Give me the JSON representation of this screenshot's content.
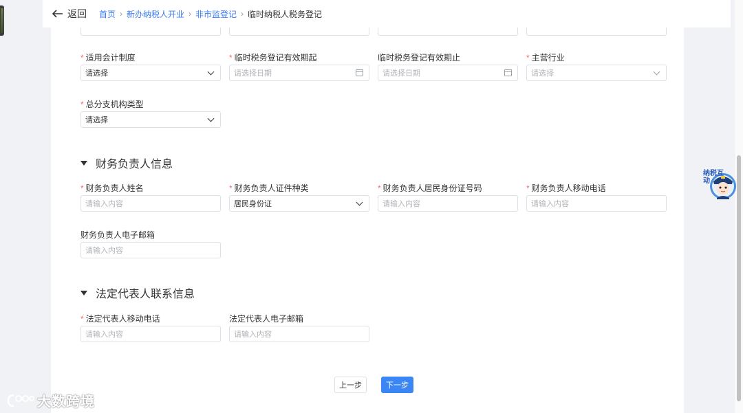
{
  "header": {
    "back_label": "返回",
    "breadcrumb": [
      "首页",
      "新办纳税人开业",
      "非市监登记",
      "临时纳税人税务登记"
    ]
  },
  "section1": {
    "fields": [
      {
        "label": "适用会计制度",
        "required": true,
        "value": "请选择",
        "placeholder": "",
        "kind": "select"
      },
      {
        "label": "临时税务登记有效期起",
        "required": true,
        "value": "",
        "placeholder": "请选择日期",
        "kind": "date"
      },
      {
        "label": "临时税务登记有效期止",
        "required": false,
        "value": "",
        "placeholder": "请选择日期",
        "kind": "date"
      },
      {
        "label": "主营行业",
        "required": true,
        "value": "",
        "placeholder": "请选择",
        "kind": "select"
      },
      {
        "label": "总分支机构类型",
        "required": true,
        "value": "请选择",
        "placeholder": "",
        "kind": "select"
      }
    ]
  },
  "finance_section": {
    "title": "财务负责人信息",
    "fields": [
      {
        "label": "财务负责人姓名",
        "required": true,
        "placeholder": "请输入内容"
      },
      {
        "label": "财务负责人证件种类",
        "required": true,
        "value": "居民身份证"
      },
      {
        "label": "财务负责人居民身份证号码",
        "required": true,
        "placeholder": "请输入内容"
      },
      {
        "label": "财务负责人移动电话",
        "required": true,
        "placeholder": "请输入内容"
      },
      {
        "label": "财务负责人电子邮箱",
        "required": false,
        "placeholder": "请输入内容"
      }
    ]
  },
  "legal_section": {
    "title": "法定代表人联系信息",
    "fields": [
      {
        "label": "法定代表人移动电话",
        "required": true,
        "placeholder": "请输入内容"
      },
      {
        "label": "法定代表人电子邮箱",
        "required": false,
        "placeholder": "请输入内容"
      }
    ]
  },
  "actions": {
    "prev_label": "上一步",
    "next_label": "下一步"
  },
  "assistant": {
    "label": "纳税互动",
    "icon": "robot-avatar-icon"
  },
  "watermark": {
    "text": "大数跨境"
  },
  "colors": {
    "accent": "#3a86f5",
    "link": "#3a7cf0",
    "required": "#f56c6c"
  }
}
